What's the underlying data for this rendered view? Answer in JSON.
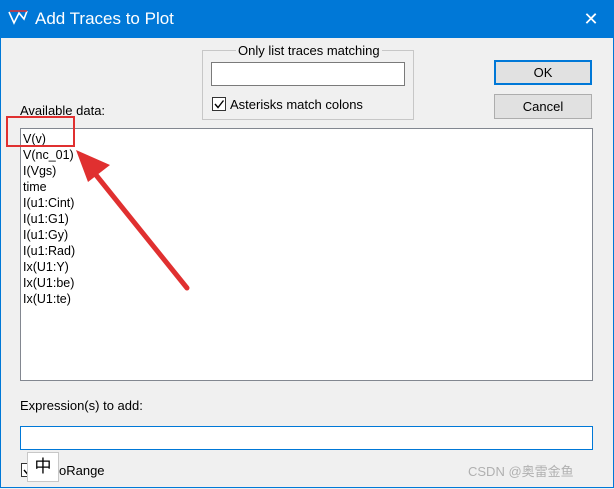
{
  "window": {
    "title": "Add Traces to Plot",
    "close_glyph": "✕"
  },
  "filter": {
    "legend": "Only list traces matching",
    "value": "",
    "asterisks_label": "Asterisks match colons",
    "asterisks_checked": true
  },
  "buttons": {
    "ok": "OK",
    "cancel": "Cancel"
  },
  "available": {
    "label": "Available data:",
    "items": [
      "V(v)",
      "V(nc_01)",
      "I(Vgs)",
      "time",
      "I(u1:Cint)",
      "I(u1:G1)",
      "I(u1:Gy)",
      "I(u1:Rad)",
      "Ix(U1:Y)",
      "Ix(U1:be)",
      "Ix(U1:te)"
    ]
  },
  "expression": {
    "label": "Expression(s) to add:",
    "value": ""
  },
  "autorange": {
    "label_visible": "oRange",
    "checked": true
  },
  "ime": {
    "glyph": "中"
  },
  "watermark": "CSDN @奥雷金鱼",
  "colors": {
    "titlebar": "#0078d7",
    "annotation": "#e03030"
  }
}
